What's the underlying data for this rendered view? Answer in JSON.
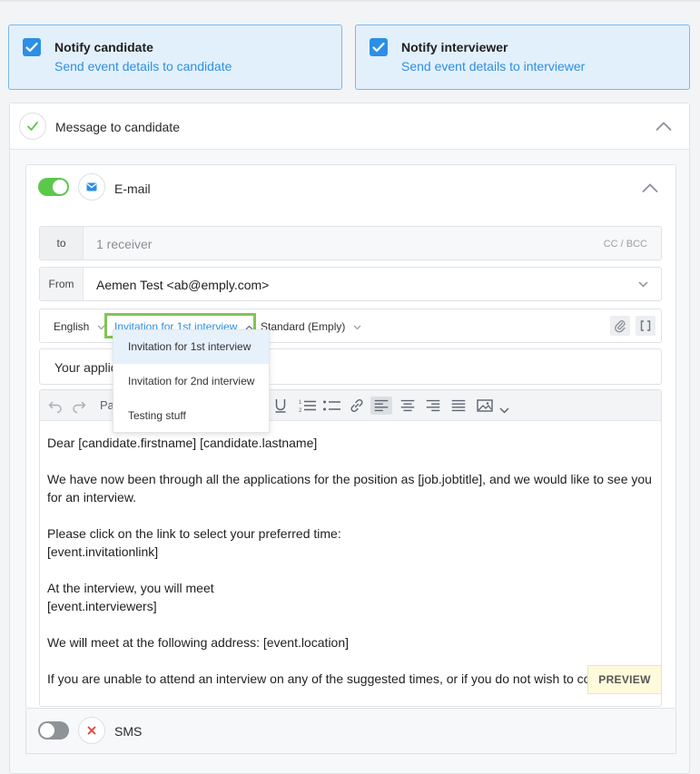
{
  "notify": {
    "candidate": {
      "title": "Notify candidate",
      "subtitle": "Send event details to candidate"
    },
    "interviewer": {
      "title": "Notify interviewer",
      "subtitle": "Send event details to interviewer"
    }
  },
  "message": {
    "title": "Message to candidate",
    "email": {
      "label": "E-mail",
      "enabled": true,
      "to_label": "to",
      "to_value": "1 receiver",
      "cc_bcc": "CC / BCC",
      "from_label": "From",
      "from_value": "Aemen Test <ab@emply.com>",
      "language": "English",
      "template": "Invitation for 1st interview",
      "layout": "Standard (Emply)",
      "subject": "Your applic",
      "toolbar_paragraph": "Pa",
      "body": [
        "Dear [candidate.firstname] [candidate.lastname]",
        "We have now been through all the applications for the position as [job.jobtitle], and we would like to see you for an interview.",
        "Please click on the link to select your preferred time:\n[event.invitationlink]",
        "At the interview, you will meet\n[event.interviewers]",
        "We will meet at the following address: [event.location]",
        "If you are unable to attend an interview on any of the suggested times, or if you do not wish to co"
      ],
      "preview_label": "PREVIEW"
    },
    "sms": {
      "label": "SMS",
      "enabled": false
    }
  },
  "template_dropdown": {
    "options": [
      "Invitation for 1st interview",
      "Invitation for 2nd interview",
      "Testing stuff"
    ],
    "selected_index": 0
  },
  "colors": {
    "accent_blue": "#2d8ee6",
    "toggle_on": "#5cc84a",
    "highlight_green": "#82c455",
    "close_red": "#e2403a"
  }
}
